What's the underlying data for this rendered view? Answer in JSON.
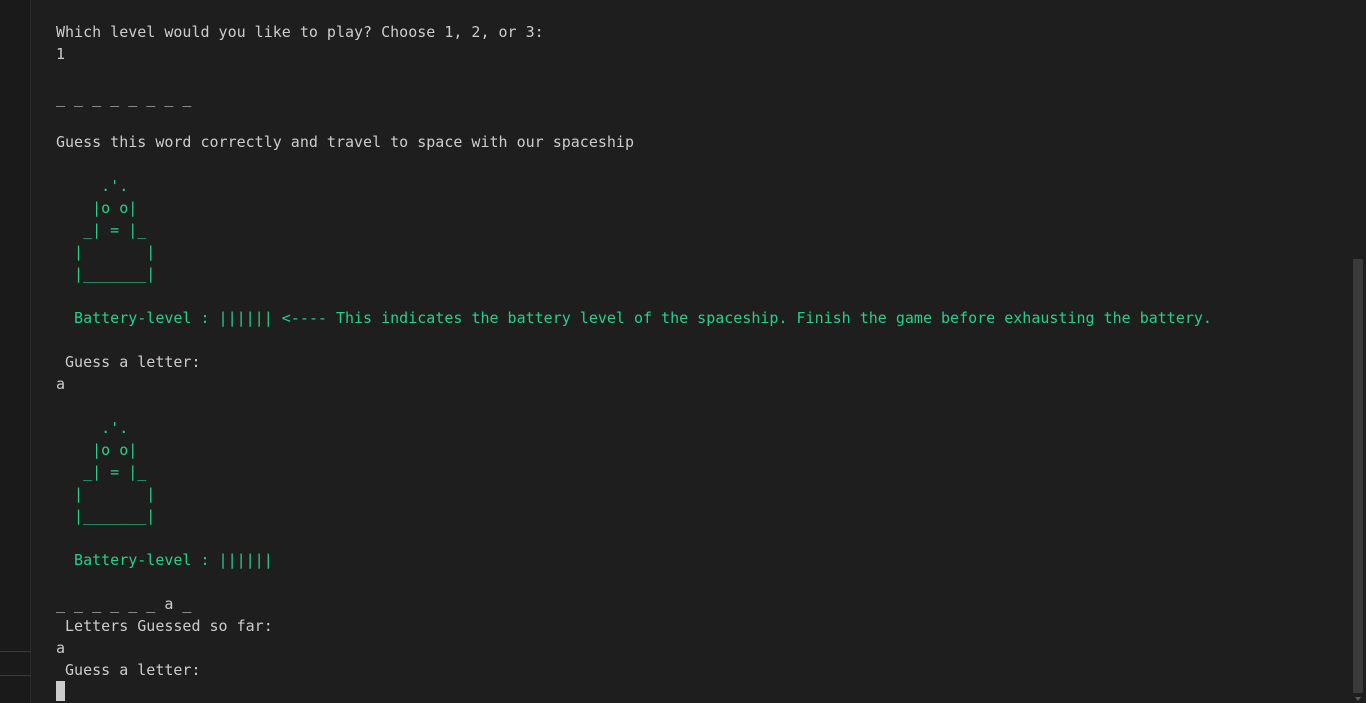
{
  "terminal": {
    "lines": [
      {
        "text": "Which level would you like to play? Choose 1, 2, or 3:",
        "color": "default"
      },
      {
        "text": "1",
        "color": "default"
      },
      {
        "text": "",
        "color": "default"
      },
      {
        "text": "_ _ _ _ _ _ _ _",
        "color": "default"
      },
      {
        "text": "",
        "color": "default"
      },
      {
        "text": "Guess this word correctly and travel to space with our spaceship",
        "color": "default"
      },
      {
        "text": "",
        "color": "default"
      },
      {
        "text": "     .'.",
        "color": "green"
      },
      {
        "text": "    |o o|",
        "color": "green"
      },
      {
        "text": "   _| = |_",
        "color": "green"
      },
      {
        "text": "  |       |",
        "color": "green"
      },
      {
        "text": "  |_______|",
        "color": "green"
      },
      {
        "text": "",
        "color": "default"
      },
      {
        "text": "  Battery-level : |||||| <---- This indicates the battery level of the spaceship. Finish the game before exhausting the battery.",
        "color": "green"
      },
      {
        "text": "",
        "color": "default"
      },
      {
        "text": " Guess a letter:",
        "color": "default"
      },
      {
        "text": "a",
        "color": "default"
      },
      {
        "text": "",
        "color": "default"
      },
      {
        "text": "     .'.",
        "color": "green"
      },
      {
        "text": "    |o o|",
        "color": "green"
      },
      {
        "text": "   _| = |_",
        "color": "green"
      },
      {
        "text": "  |       |",
        "color": "green"
      },
      {
        "text": "  |_______|",
        "color": "green"
      },
      {
        "text": "",
        "color": "default"
      },
      {
        "text": "  Battery-level : ||||||",
        "color": "green"
      },
      {
        "text": "",
        "color": "default"
      },
      {
        "text": "_ _ _ _ _ _ a _",
        "color": "default"
      },
      {
        "text": " Letters Guessed so far:",
        "color": "default"
      },
      {
        "text": "a",
        "color": "default"
      },
      {
        "text": " Guess a letter:",
        "color": "default"
      }
    ],
    "colors": {
      "default": "#cccccc",
      "green": "#23d18b",
      "background": "#1e1e1e"
    }
  }
}
